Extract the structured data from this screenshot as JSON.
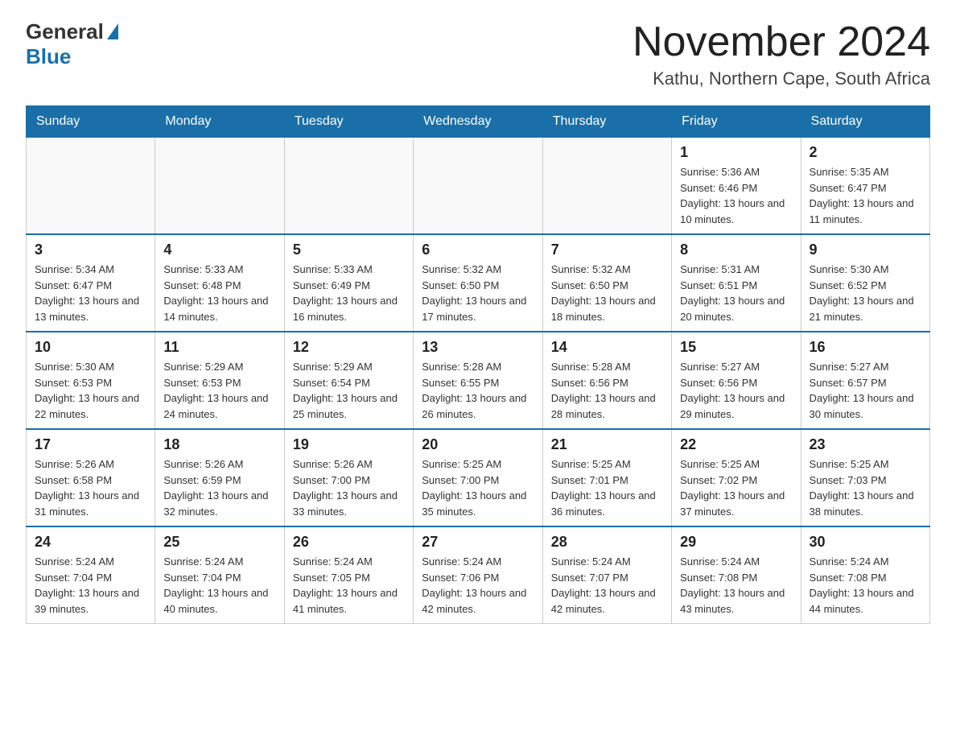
{
  "header": {
    "logo_general": "General",
    "logo_blue": "Blue",
    "month_title": "November 2024",
    "location": "Kathu, Northern Cape, South Africa"
  },
  "weekdays": [
    "Sunday",
    "Monday",
    "Tuesday",
    "Wednesday",
    "Thursday",
    "Friday",
    "Saturday"
  ],
  "weeks": [
    [
      {
        "day": "",
        "info": ""
      },
      {
        "day": "",
        "info": ""
      },
      {
        "day": "",
        "info": ""
      },
      {
        "day": "",
        "info": ""
      },
      {
        "day": "",
        "info": ""
      },
      {
        "day": "1",
        "info": "Sunrise: 5:36 AM\nSunset: 6:46 PM\nDaylight: 13 hours and 10 minutes."
      },
      {
        "day": "2",
        "info": "Sunrise: 5:35 AM\nSunset: 6:47 PM\nDaylight: 13 hours and 11 minutes."
      }
    ],
    [
      {
        "day": "3",
        "info": "Sunrise: 5:34 AM\nSunset: 6:47 PM\nDaylight: 13 hours and 13 minutes."
      },
      {
        "day": "4",
        "info": "Sunrise: 5:33 AM\nSunset: 6:48 PM\nDaylight: 13 hours and 14 minutes."
      },
      {
        "day": "5",
        "info": "Sunrise: 5:33 AM\nSunset: 6:49 PM\nDaylight: 13 hours and 16 minutes."
      },
      {
        "day": "6",
        "info": "Sunrise: 5:32 AM\nSunset: 6:50 PM\nDaylight: 13 hours and 17 minutes."
      },
      {
        "day": "7",
        "info": "Sunrise: 5:32 AM\nSunset: 6:50 PM\nDaylight: 13 hours and 18 minutes."
      },
      {
        "day": "8",
        "info": "Sunrise: 5:31 AM\nSunset: 6:51 PM\nDaylight: 13 hours and 20 minutes."
      },
      {
        "day": "9",
        "info": "Sunrise: 5:30 AM\nSunset: 6:52 PM\nDaylight: 13 hours and 21 minutes."
      }
    ],
    [
      {
        "day": "10",
        "info": "Sunrise: 5:30 AM\nSunset: 6:53 PM\nDaylight: 13 hours and 22 minutes."
      },
      {
        "day": "11",
        "info": "Sunrise: 5:29 AM\nSunset: 6:53 PM\nDaylight: 13 hours and 24 minutes."
      },
      {
        "day": "12",
        "info": "Sunrise: 5:29 AM\nSunset: 6:54 PM\nDaylight: 13 hours and 25 minutes."
      },
      {
        "day": "13",
        "info": "Sunrise: 5:28 AM\nSunset: 6:55 PM\nDaylight: 13 hours and 26 minutes."
      },
      {
        "day": "14",
        "info": "Sunrise: 5:28 AM\nSunset: 6:56 PM\nDaylight: 13 hours and 28 minutes."
      },
      {
        "day": "15",
        "info": "Sunrise: 5:27 AM\nSunset: 6:56 PM\nDaylight: 13 hours and 29 minutes."
      },
      {
        "day": "16",
        "info": "Sunrise: 5:27 AM\nSunset: 6:57 PM\nDaylight: 13 hours and 30 minutes."
      }
    ],
    [
      {
        "day": "17",
        "info": "Sunrise: 5:26 AM\nSunset: 6:58 PM\nDaylight: 13 hours and 31 minutes."
      },
      {
        "day": "18",
        "info": "Sunrise: 5:26 AM\nSunset: 6:59 PM\nDaylight: 13 hours and 32 minutes."
      },
      {
        "day": "19",
        "info": "Sunrise: 5:26 AM\nSunset: 7:00 PM\nDaylight: 13 hours and 33 minutes."
      },
      {
        "day": "20",
        "info": "Sunrise: 5:25 AM\nSunset: 7:00 PM\nDaylight: 13 hours and 35 minutes."
      },
      {
        "day": "21",
        "info": "Sunrise: 5:25 AM\nSunset: 7:01 PM\nDaylight: 13 hours and 36 minutes."
      },
      {
        "day": "22",
        "info": "Sunrise: 5:25 AM\nSunset: 7:02 PM\nDaylight: 13 hours and 37 minutes."
      },
      {
        "day": "23",
        "info": "Sunrise: 5:25 AM\nSunset: 7:03 PM\nDaylight: 13 hours and 38 minutes."
      }
    ],
    [
      {
        "day": "24",
        "info": "Sunrise: 5:24 AM\nSunset: 7:04 PM\nDaylight: 13 hours and 39 minutes."
      },
      {
        "day": "25",
        "info": "Sunrise: 5:24 AM\nSunset: 7:04 PM\nDaylight: 13 hours and 40 minutes."
      },
      {
        "day": "26",
        "info": "Sunrise: 5:24 AM\nSunset: 7:05 PM\nDaylight: 13 hours and 41 minutes."
      },
      {
        "day": "27",
        "info": "Sunrise: 5:24 AM\nSunset: 7:06 PM\nDaylight: 13 hours and 42 minutes."
      },
      {
        "day": "28",
        "info": "Sunrise: 5:24 AM\nSunset: 7:07 PM\nDaylight: 13 hours and 42 minutes."
      },
      {
        "day": "29",
        "info": "Sunrise: 5:24 AM\nSunset: 7:08 PM\nDaylight: 13 hours and 43 minutes."
      },
      {
        "day": "30",
        "info": "Sunrise: 5:24 AM\nSunset: 7:08 PM\nDaylight: 13 hours and 44 minutes."
      }
    ]
  ]
}
